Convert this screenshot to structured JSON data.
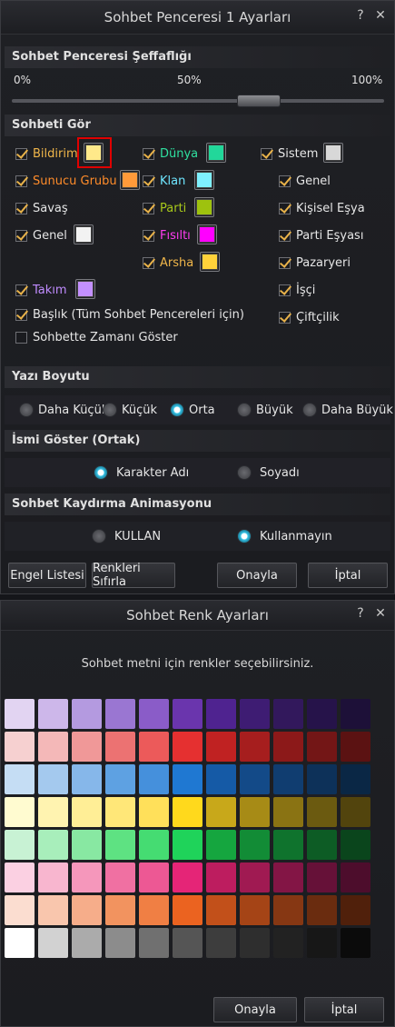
{
  "settings_window": {
    "title": "Sohbet Penceresi 1 Ayarları",
    "help": "?",
    "close": "✕",
    "transparency": {
      "header": "Sohbet Penceresi Şeffaflığı",
      "min_label": "0%",
      "mid_label": "50%",
      "max_label": "100%",
      "value_percent": 68
    },
    "view_header": "Sohbeti Gör",
    "items": {
      "bildirim": {
        "label": "Bildirim",
        "checked": true,
        "color": "#ffe98a",
        "label_color": "#f0b64a"
      },
      "sunucu": {
        "label": "Sunucu Grubu",
        "checked": true,
        "color": "#ff9a3a",
        "label_color": "#ff8c2a"
      },
      "savas": {
        "label": "Savaş",
        "checked": true
      },
      "genel": {
        "label": "Genel",
        "checked": true,
        "color": "#f2f2f2"
      },
      "dunya": {
        "label": "Dünya",
        "checked": true,
        "color": "#22d79a",
        "label_color": "#2fe0a0"
      },
      "klan": {
        "label": "Klan",
        "checked": true,
        "color": "#7ef0ff",
        "label_color": "#6fe6ff"
      },
      "parti": {
        "label": "Parti",
        "checked": true,
        "color": "#9ec20e",
        "label_color": "#a8c81a"
      },
      "fisilti": {
        "label": "Fısıltı",
        "checked": true,
        "color": "#ff00ff",
        "label_color": "#ff3cf0"
      },
      "arsha": {
        "label": "Arsha",
        "checked": true,
        "color": "#ffd23a",
        "label_color": "#f0b64a"
      },
      "sistem": {
        "label": "Sistem",
        "checked": true,
        "color": "#d8d8d8"
      },
      "s_genel": {
        "label": "Genel",
        "checked": true
      },
      "kisisel": {
        "label": "Kişisel Eşya",
        "checked": true
      },
      "parti_esya": {
        "label": "Parti Eşyası",
        "checked": true
      },
      "pazaryeri": {
        "label": "Pazaryeri",
        "checked": true
      },
      "isci": {
        "label": "İşçi",
        "checked": true
      },
      "ciftcilik": {
        "label": "Çiftçilik",
        "checked": true
      },
      "takim": {
        "label": "Takım",
        "checked": true,
        "color": "#c390ff",
        "label_color": "#c08cff"
      },
      "baslik": {
        "label": "Başlık (Tüm Sohbet Pencereleri için)",
        "checked": true
      },
      "zaman": {
        "label": "Sohbette Zamanı Göster",
        "checked": false
      }
    },
    "font_size": {
      "header": "Yazı Boyutu",
      "options": [
        "Daha Küçük",
        "Küçük",
        "Orta",
        "Büyük",
        "Daha Büyük"
      ],
      "selected": "Orta"
    },
    "name_display": {
      "header": "İsmi Göster (Ortak)",
      "options": [
        "Karakter Adı",
        "Soyadı"
      ],
      "selected": "Karakter Adı"
    },
    "scroll_anim": {
      "header": "Sohbet Kaydırma Animasyonu",
      "options": [
        "KULLAN",
        "Kullanmayın"
      ],
      "selected": "Kullanmayın"
    },
    "buttons": {
      "block_list": "Engel Listesi",
      "reset_colors": "Renkleri Sıfırla",
      "confirm": "Onayla",
      "cancel": "İptal"
    }
  },
  "color_window": {
    "title": "Sohbet Renk Ayarları",
    "help": "?",
    "close": "✕",
    "description": "Sohbet metni için renkler seçebilirsiniz.",
    "palette_rows": [
      [
        "#e2d4f2",
        "#cdb7ea",
        "#b49ae0",
        "#9a76d2",
        "#8a5cc8",
        "#6a35ad",
        "#4f2390",
        "#3e1c73",
        "#32185c",
        "#26134a",
        "#1d1038"
      ],
      [
        "#f6d0d0",
        "#f4b8b8",
        "#f09898",
        "#ec7272",
        "#ec5a5a",
        "#e53030",
        "#c02222",
        "#a61e1e",
        "#8c1919",
        "#731616",
        "#5b1212"
      ],
      [
        "#c5ddf4",
        "#a4c9ee",
        "#86b7ea",
        "#5ea1e2",
        "#4590dc",
        "#1f78d2",
        "#155aa6",
        "#134a88",
        "#103d70",
        "#0d3159",
        "#0a2745"
      ],
      [
        "#fffbd0",
        "#fff3b0",
        "#ffee96",
        "#ffe778",
        "#ffe05a",
        "#ffd91c",
        "#c8a81a",
        "#a78b16",
        "#8a7313",
        "#6b5a10",
        "#52440d"
      ],
      [
        "#c8f2d4",
        "#a8eebb",
        "#88e8a2",
        "#5ee282",
        "#45dc72",
        "#1fd35a",
        "#15a63f",
        "#128c36",
        "#0f732d",
        "#0d5c25",
        "#0a451c"
      ],
      [
        "#fbd0e2",
        "#f8b6cf",
        "#f597bb",
        "#f070a2",
        "#ed5894",
        "#e52577",
        "#bd1d5f",
        "#a01a52",
        "#831545",
        "#661138",
        "#4d0d2c"
      ],
      [
        "#fbddd0",
        "#f9c6ad",
        "#f6ad8a",
        "#f2935f",
        "#f07f44",
        "#eb6320",
        "#c2501a",
        "#a54416",
        "#863713",
        "#6a2c0f",
        "#50200b"
      ],
      [
        "#ffffff",
        "#d2d2d2",
        "#ababab",
        "#8c8c8c",
        "#707070",
        "#555555",
        "#3d3d3d",
        "#2e2e2e",
        "#222222",
        "#171717",
        "#0b0b0b"
      ]
    ],
    "buttons": {
      "confirm": "Onayla",
      "cancel": "İptal"
    }
  }
}
